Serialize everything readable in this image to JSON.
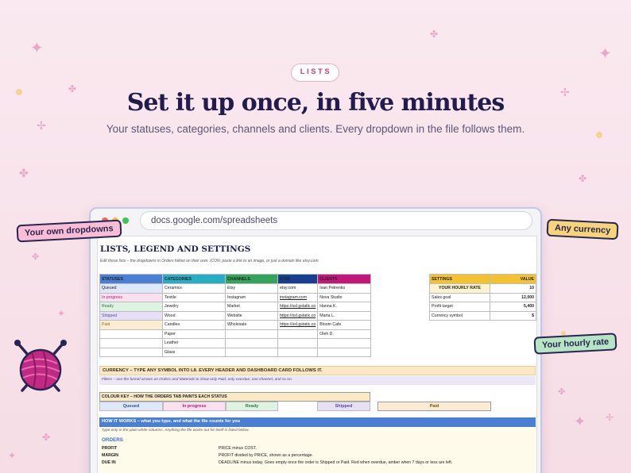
{
  "pill": "LISTS",
  "headline": "Set it up once, in five minutes",
  "subheadline": "Your statuses, categories, channels and clients. Every dropdown in the file follows them.",
  "browser": {
    "url": "docs.google.com/spreadsheets"
  },
  "callouts": {
    "dropdowns": "Your own dropdowns",
    "currency": "Any currency",
    "hourly": "Your hourly rate"
  },
  "colors": {
    "accent": "#c2407a",
    "headline": "#211c4c",
    "statuses": "#4a7fd4",
    "categories": "#27aec4",
    "channels": "#36a35c",
    "icon": "#163f8f",
    "clients": "#c2177a",
    "settings": "#f2c230"
  },
  "sheet": {
    "title": "LISTS, LEGEND AND SETTINGS",
    "note": "Edit these lists – the dropdowns in Orders follow on their own. ICON: paste a link to an image, or just a domain like etsy.com.",
    "lists": {
      "headers": {
        "statuses": "STATUSES",
        "categories": "CATEGORIES",
        "channels": "CHANNELS",
        "icon": "ICON",
        "clients": "CLIENTS"
      },
      "statuses": [
        "Queued",
        "In progress",
        "Ready",
        "Shipped",
        "Paid"
      ],
      "categories": [
        "Ceramics",
        "Textile",
        "Jewelry",
        "Wood",
        "Candles",
        "Paper",
        "Leather",
        "Glass"
      ],
      "channels": [
        "Etsy",
        "Instagram",
        "Market",
        "Website",
        "Wholesale"
      ],
      "icons": [
        "etsy.com",
        "instagram.com",
        "https://ssl.gstatic.co",
        "https://ssl.gstatic.co",
        "https://ssl.gstatic.co"
      ],
      "clients": [
        "Ivan Petrenko",
        "Nova Studio",
        "Hanna K.",
        "Marta L.",
        "Bloom Cafe",
        "Oleh D."
      ]
    },
    "settings": {
      "header_label": "SETTINGS",
      "header_value": "VALUE",
      "rows": [
        {
          "label": "YOUR HOURLY RATE",
          "value": "10"
        },
        {
          "label": "Sales goal",
          "value": "12,000"
        },
        {
          "label": "Profit target",
          "value": "5,400"
        },
        {
          "label": "Currency symbol",
          "value": "$"
        }
      ]
    },
    "currency_banner": "CURRENCY – TYPE ANY SYMBOL INTO L8. EVERY HEADER AND DASHBOARD CARD FOLLOWS IT.",
    "filters_note": "Filters – use the funnel arrows on Orders and Materials to show only Paid, only overdue, one channel, and so on.",
    "colour_key": {
      "title": "COLOUR KEY  –  HOW THE ORDERS TAB PAINTS EACH STATUS",
      "items": [
        "Queued",
        "In progress",
        "Ready",
        "Shipped",
        "Paid"
      ]
    },
    "how": {
      "title": "HOW IT WORKS  –  what you type, and what the file counts for you",
      "note": "Type only in the plain white columns. Anything the file works out for itself is listed below.",
      "section": "ORDERS",
      "rows": [
        {
          "term": "PROFIT",
          "desc": "PRICE minus COST."
        },
        {
          "term": "MARGIN",
          "desc": "PROFIT divided by PRICE, shown as a percentage."
        },
        {
          "term": "DUE IN",
          "desc": "DEADLINE minus today. Goes empty once the order is Shipped or Paid. Red when overdue, amber when 7 days or less are left."
        }
      ]
    }
  }
}
